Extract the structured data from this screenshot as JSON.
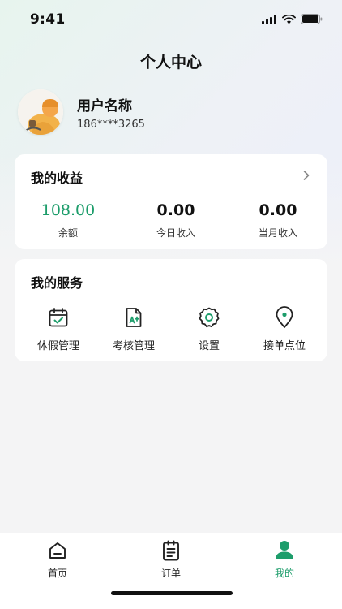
{
  "status_bar": {
    "time": "9:41"
  },
  "nav": {
    "title": "个人中心"
  },
  "profile": {
    "name": "用户名称",
    "phone": "186****3265"
  },
  "income": {
    "title": "我的收益",
    "stats": [
      {
        "value": "108.00",
        "label": "余额"
      },
      {
        "value": "0.00",
        "label": "今日收入"
      },
      {
        "value": "0.00",
        "label": "当月收入"
      }
    ]
  },
  "services": {
    "title": "我的服务",
    "items": [
      {
        "label": "休假管理",
        "icon": "calendar-check-icon"
      },
      {
        "label": "考核管理",
        "icon": "document-grade-icon"
      },
      {
        "label": "设置",
        "icon": "gear-icon"
      },
      {
        "label": "接单点位",
        "icon": "location-pin-icon"
      }
    ]
  },
  "tabbar": {
    "items": [
      {
        "label": "首页",
        "icon": "home-icon"
      },
      {
        "label": "订单",
        "icon": "clipboard-icon"
      },
      {
        "label": "我的",
        "icon": "user-icon",
        "active": true
      }
    ]
  },
  "colors": {
    "accent": "#1d9d6b"
  }
}
